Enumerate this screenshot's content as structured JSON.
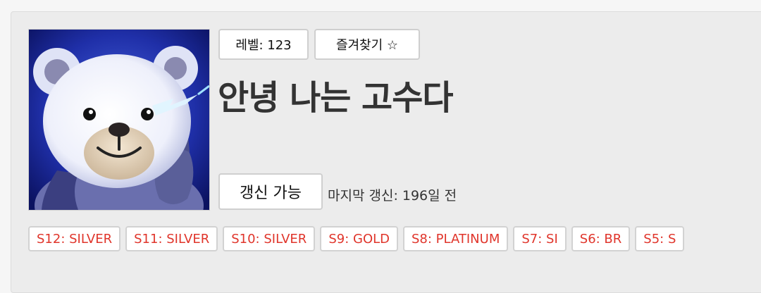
{
  "profile": {
    "level_label": "레벨: 123",
    "favorite_label": "즐겨찾기 ☆",
    "name": "안녕 나는 고수다",
    "refresh_label": "갱신 가능",
    "last_update": "마지막 갱신: 196일 전",
    "avatar_icon": "polar-bear-icon"
  },
  "seasons": [
    {
      "label": "S12: SILVER"
    },
    {
      "label": "S11: SILVER"
    },
    {
      "label": "S10: SILVER"
    },
    {
      "label": "S9: GOLD"
    },
    {
      "label": "S8: PLATINUM"
    },
    {
      "label": "S7: SI"
    },
    {
      "label": "S6: BR"
    },
    {
      "label": "S5: S"
    }
  ],
  "colors": {
    "season_text": "#e0352b",
    "title": "#333333"
  }
}
